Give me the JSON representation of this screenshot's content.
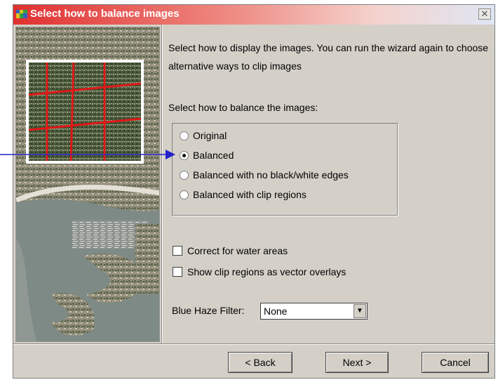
{
  "window": {
    "title": "Select how to balance images",
    "close_symbol": "✕"
  },
  "intro_text": "Select how to display the images. You can run the wizard again to choose alternative ways to clip images",
  "balance": {
    "label": "Select how to balance the images:",
    "options": [
      {
        "label": "Original",
        "selected": false
      },
      {
        "label": "Balanced",
        "selected": true
      },
      {
        "label": "Balanced with no black/white edges",
        "selected": false
      },
      {
        "label": "Balanced with clip regions",
        "selected": false
      }
    ]
  },
  "checkboxes": [
    {
      "label": "Correct for water areas",
      "checked": false
    },
    {
      "label": "Show clip regions as vector overlays",
      "checked": false
    }
  ],
  "haze": {
    "label": "Blue Haze Filter:",
    "value": "None"
  },
  "buttons": {
    "back": "< Back",
    "next": "Next >",
    "cancel": "Cancel"
  },
  "colors": {
    "titlebar_start": "#e03030",
    "callout_arrow": "#2222cc",
    "clip_lines": "#e01818"
  }
}
